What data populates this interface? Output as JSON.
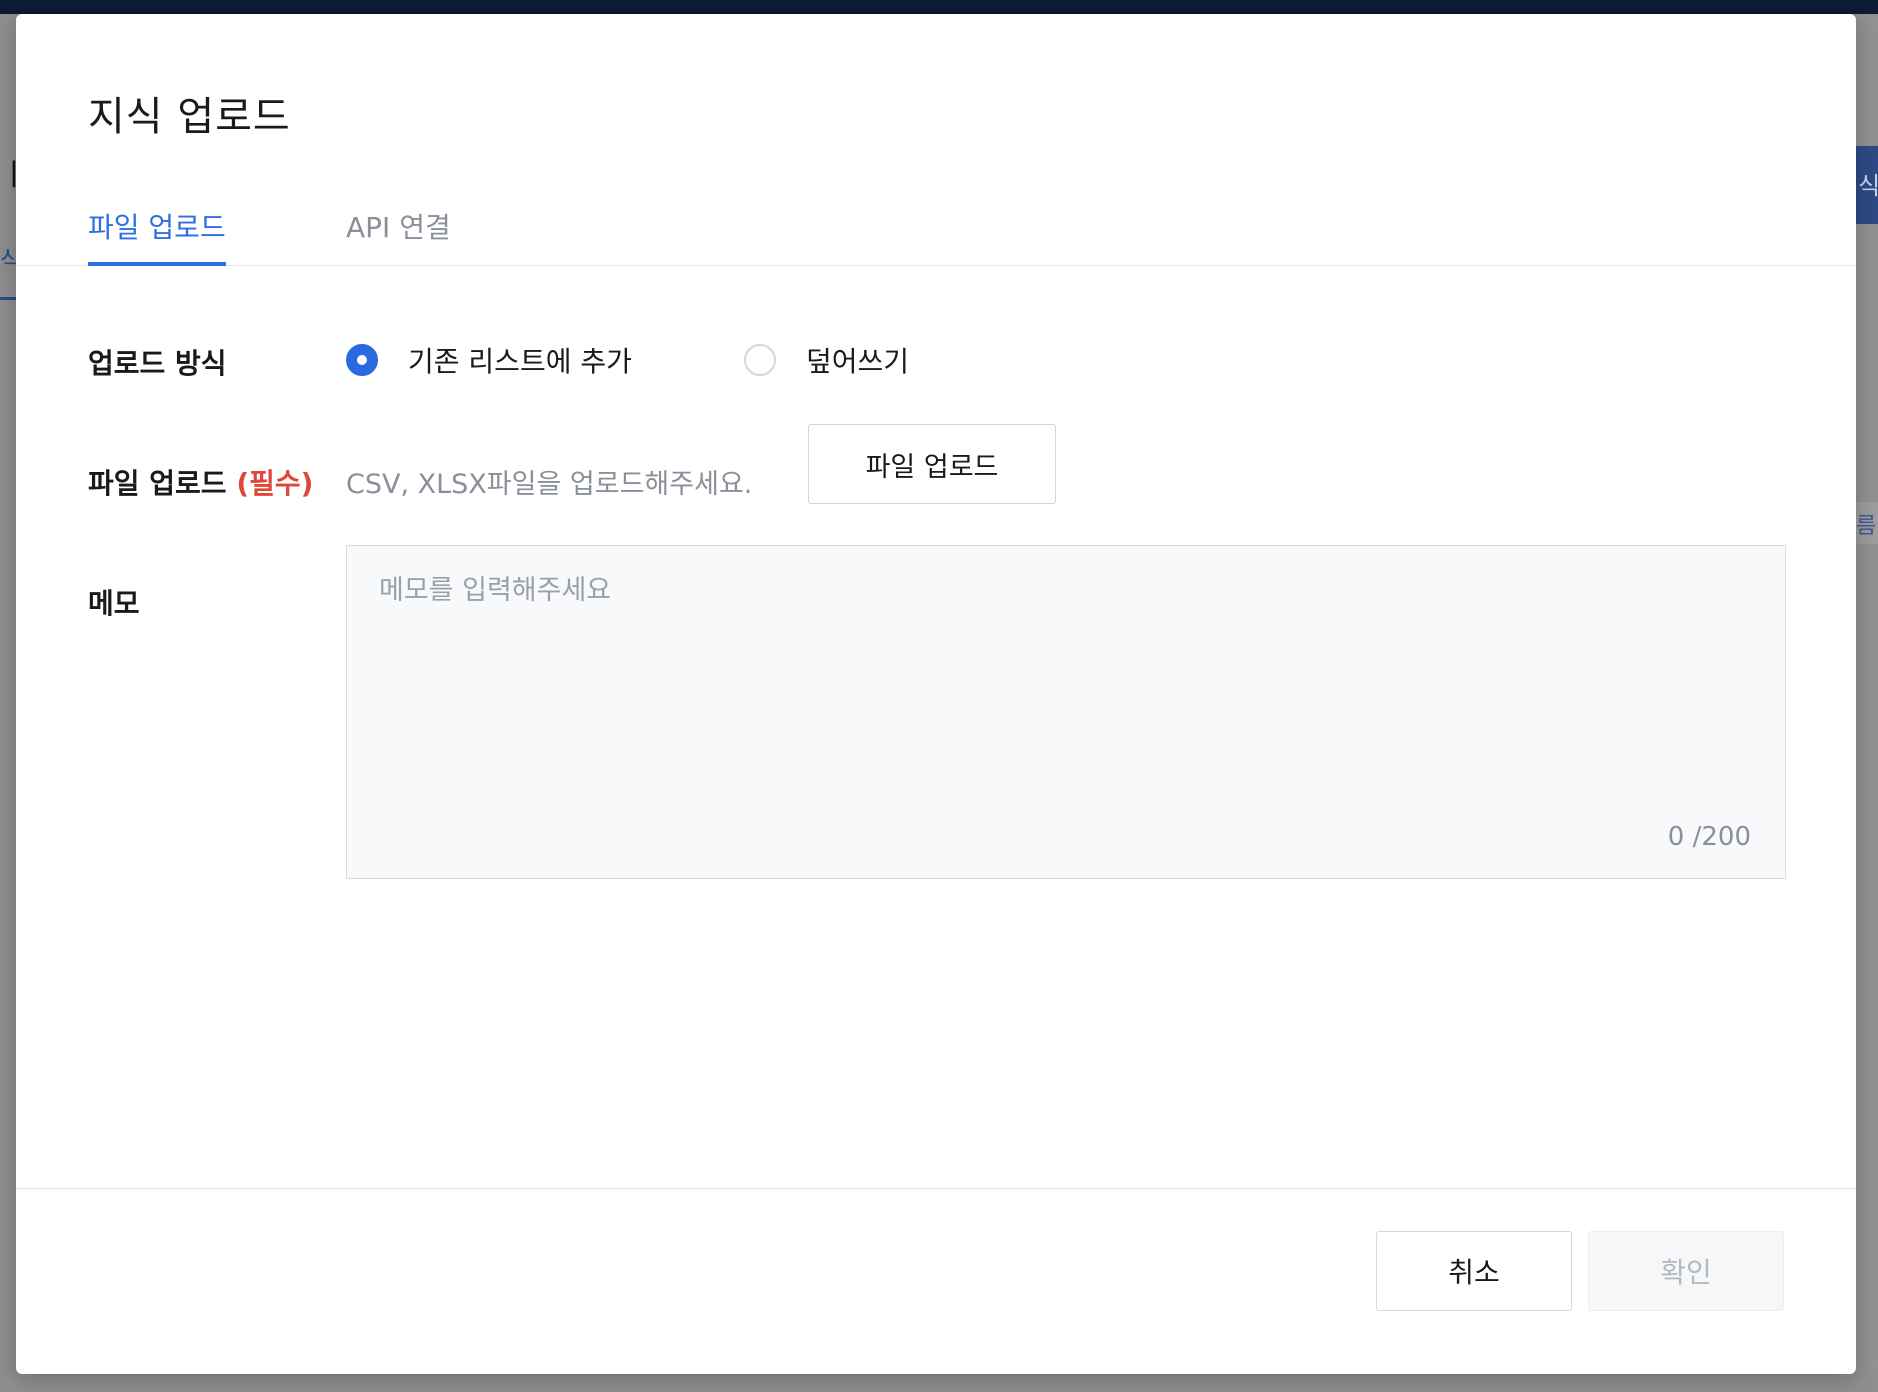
{
  "modal": {
    "title": "지식 업로드"
  },
  "tabs": [
    {
      "label": "파일 업로드",
      "active": true
    },
    {
      "label": "API 연결",
      "active": false
    }
  ],
  "upload_method": {
    "label": "업로드 방식",
    "options": [
      {
        "label": "기존 리스트에 추가",
        "checked": true
      },
      {
        "label": "덮어쓰기",
        "checked": false
      }
    ]
  },
  "file_upload": {
    "label": "파일 업로드",
    "required": "(필수)",
    "hint": "CSV, XLSX파일을 업로드해주세요.",
    "button_label": "파일 업로드"
  },
  "memo": {
    "label": "메모",
    "placeholder": "메모를 입력해주세요",
    "value": "",
    "counter": "0 /200"
  },
  "footer": {
    "cancel_label": "취소",
    "confirm_label": "확인"
  },
  "colors": {
    "accent": "#2f6fe0",
    "required": "#e2463a",
    "topbar": "#0d1b33"
  }
}
